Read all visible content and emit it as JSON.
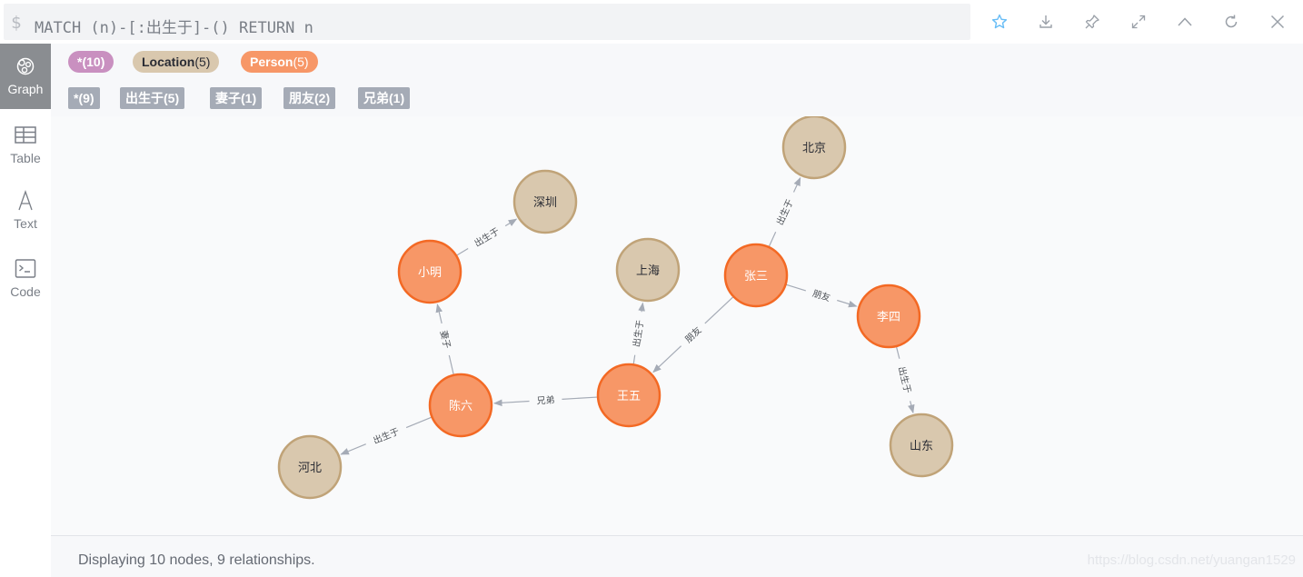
{
  "query": {
    "prompt": "$",
    "text": "MATCH (n)-[:出生于]-() RETURN n"
  },
  "toolbar": {
    "icons": [
      "star-icon",
      "download-icon",
      "pin-icon",
      "expand-icon",
      "collapse-up-icon",
      "refresh-icon",
      "close-icon"
    ]
  },
  "sidebar": {
    "items": [
      {
        "label": "Graph",
        "icon": "graph-icon",
        "active": true
      },
      {
        "label": "Table",
        "icon": "table-icon",
        "active": false
      },
      {
        "label": "Text",
        "icon": "text-icon",
        "active": false
      },
      {
        "label": "Code",
        "icon": "code-icon",
        "active": false
      }
    ]
  },
  "legend": {
    "node_labels": [
      {
        "name": "*",
        "count": "(10)",
        "color": "#c990c0",
        "text_color": "#ffffff"
      },
      {
        "name": "Location",
        "count": "(5)",
        "color": "#d9c8ae",
        "text_color": "#2a2c34"
      },
      {
        "name": "Person",
        "count": "(5)",
        "color": "#f79767",
        "text_color": "#ffffff"
      }
    ],
    "rel_types": [
      {
        "text": "*(9)"
      },
      {
        "text": "出生于(5)"
      },
      {
        "text": "妻子(1)"
      },
      {
        "text": "朋友(2)"
      },
      {
        "text": "兄弟(1)"
      }
    ]
  },
  "graph": {
    "colors": {
      "person_fill": "#f79767",
      "person_stroke": "#f36924",
      "location_fill": "#d9c8ae",
      "location_stroke": "#c0a378",
      "edge": "#a5abb6"
    },
    "nodes": [
      {
        "id": "zhangsan",
        "name": "张三",
        "label": "Person"
      },
      {
        "id": "lisi",
        "name": "李四",
        "label": "Person"
      },
      {
        "id": "wangwu",
        "name": "王五",
        "label": "Person"
      },
      {
        "id": "xiaoming",
        "name": "小明",
        "label": "Person"
      },
      {
        "id": "chenliu",
        "name": "陈六",
        "label": "Person"
      },
      {
        "id": "beijing",
        "name": "北京",
        "label": "Location"
      },
      {
        "id": "shanghai",
        "name": "上海",
        "label": "Location"
      },
      {
        "id": "shenzhen",
        "name": "深圳",
        "label": "Location"
      },
      {
        "id": "shandong",
        "name": "山东",
        "label": "Location"
      },
      {
        "id": "hebei",
        "name": "河北",
        "label": "Location"
      }
    ],
    "relationships": [
      {
        "from": "zhangsan",
        "to": "beijing",
        "type": "出生于"
      },
      {
        "from": "zhangsan",
        "to": "lisi",
        "type": "朋友"
      },
      {
        "from": "zhangsan",
        "to": "wangwu",
        "type": "朋友"
      },
      {
        "from": "lisi",
        "to": "shandong",
        "type": "出生于"
      },
      {
        "from": "wangwu",
        "to": "shanghai",
        "type": "出生于"
      },
      {
        "from": "wangwu",
        "to": "chenliu",
        "type": "兄弟"
      },
      {
        "from": "chenliu",
        "to": "xiaoming",
        "type": "妻子"
      },
      {
        "from": "chenliu",
        "to": "hebei",
        "type": "出生于"
      },
      {
        "from": "xiaoming",
        "to": "shenzhen",
        "type": "出生于"
      }
    ]
  },
  "footer": {
    "status": "Displaying 10 nodes, 9 relationships.",
    "watermark": "https://blog.csdn.net/yuangan1529"
  }
}
